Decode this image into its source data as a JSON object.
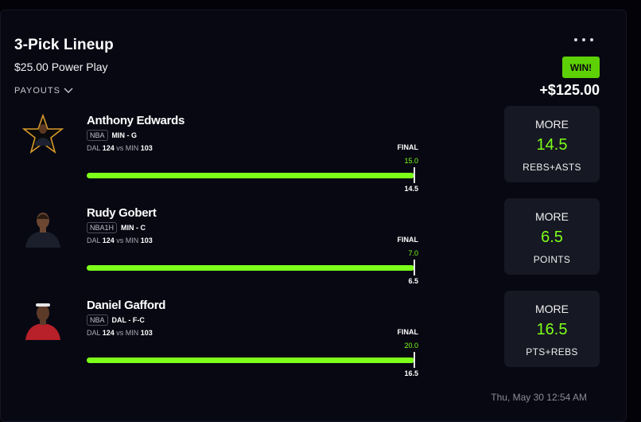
{
  "lineup": {
    "title": "3-Pick Lineup",
    "subtitle": "$25.00 Power Play",
    "payouts_label": "PAYOUTS",
    "status_badge": "WIN!",
    "payout_amount": "+$125.00",
    "timestamp": "Thu, May 30 12:54 AM"
  },
  "colors": {
    "accent_green": "#7dff1a",
    "win_badge": "#5ed106",
    "background": "#020208",
    "card": "#070812",
    "pick_box": "#161823"
  },
  "players": [
    {
      "name": "Anthony Edwards",
      "league": "NBA",
      "team_pos": "MIN - G",
      "away_team": "DAL",
      "away_score": "124",
      "vs_text": "vs MIN",
      "home_score": "103",
      "status": "FINAL",
      "actual": "15.0",
      "line": "14.5",
      "progress": 1.0,
      "pick_direction": "MORE",
      "pick_line": "14.5",
      "pick_stat": "REBS+ASTS",
      "avatar_icon": "star-avatar-icon"
    },
    {
      "name": "Rudy Gobert",
      "league": "NBA1H",
      "team_pos": "MIN - C",
      "away_team": "DAL",
      "away_score": "124",
      "vs_text": "vs MIN",
      "home_score": "103",
      "status": "FINAL",
      "actual": "7.0",
      "line": "6.5",
      "progress": 1.0,
      "pick_direction": "MORE",
      "pick_line": "6.5",
      "pick_stat": "POINTS",
      "avatar_icon": "player-headshot-icon"
    },
    {
      "name": "Daniel Gafford",
      "league": "NBA",
      "team_pos": "DAL - F-C",
      "away_team": "DAL",
      "away_score": "124",
      "vs_text": "vs MIN",
      "home_score": "103",
      "status": "FINAL",
      "actual": "20.0",
      "line": "16.5",
      "progress": 1.0,
      "pick_direction": "MORE",
      "pick_line": "16.5",
      "pick_stat": "PTS+REBS",
      "avatar_icon": "player-headshot-icon"
    }
  ]
}
